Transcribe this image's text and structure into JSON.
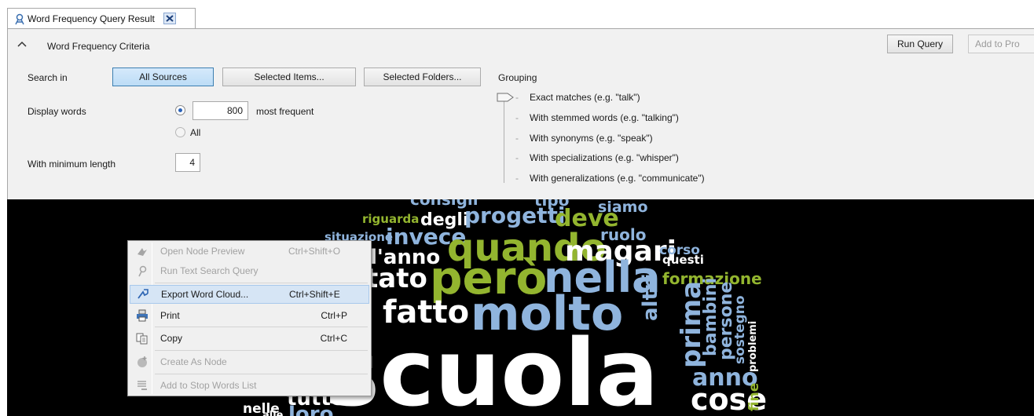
{
  "tab": {
    "title": "Word Frequency Query Result",
    "icon": "query-result-icon",
    "close_icon": "close-icon"
  },
  "criteria": {
    "title": "Word Frequency Criteria",
    "collapse_icon": "chevron-up-icon",
    "run_query_label": "Run Query",
    "add_to_project_label": "Add to Pro",
    "search_in_label": "Search in",
    "sources": {
      "all": "All Sources",
      "items": "Selected Items...",
      "folders": "Selected Folders..."
    },
    "display_words_label": "Display words",
    "display_count": "800",
    "most_frequent_label": "most frequent",
    "all_label": "All",
    "min_length_label": "With minimum length",
    "min_length_value": "4",
    "grouping_label": "Grouping",
    "grouping_options": [
      "Exact matches (e.g. \"talk\")",
      "With stemmed words (e.g. \"talking\")",
      "With synonyms (e.g. \"speak\")",
      "With specializations (e.g. \"whisper\")",
      "With generalizations (e.g. \"communicate\")"
    ],
    "grouping_selected": "Exact matches (e.g. \"talk\")"
  },
  "context_menu": {
    "items": [
      {
        "label": "Open Node Preview",
        "shortcut": "Ctrl+Shift+O",
        "enabled": false,
        "icon": "node-preview-icon"
      },
      {
        "label": "Run Text Search Query",
        "shortcut": "",
        "enabled": false,
        "icon": "text-search-icon"
      },
      {
        "label": "Export Word Cloud...",
        "shortcut": "Ctrl+Shift+E",
        "enabled": true,
        "highlighted": true,
        "icon": "export-icon"
      },
      {
        "label": "Print",
        "shortcut": "Ctrl+P",
        "enabled": true,
        "icon": "printer-icon"
      },
      {
        "label": "Copy",
        "shortcut": "Ctrl+C",
        "enabled": true,
        "icon": "copy-icon"
      },
      {
        "label": "Create As Node",
        "shortcut": "",
        "enabled": false,
        "icon": "create-node-icon"
      },
      {
        "label": "Add to Stop Words List",
        "shortcut": "",
        "enabled": false,
        "icon": "stop-words-icon"
      }
    ]
  },
  "word_cloud": {
    "colors": {
      "white": "#ffffff",
      "blue": "#8fb4dd",
      "green": "#93b52f",
      "gray": "#9a9a9a"
    },
    "words": [
      "consigli",
      "tipo",
      "siamo",
      "riguarda",
      "degli",
      "progetti",
      "deve",
      "situazione",
      "invece",
      "quando",
      "ruolo",
      "magari",
      "corso",
      "questi",
      "l'anno",
      "tato",
      "però",
      "nella",
      "altri",
      "formazione",
      "fatto",
      "molto",
      "prima",
      "bambini",
      "persone",
      "sostegno",
      "problemi",
      "scuola",
      "anno",
      "cose",
      "fine",
      "nelle",
      "loro",
      "tutte",
      "alle"
    ]
  }
}
